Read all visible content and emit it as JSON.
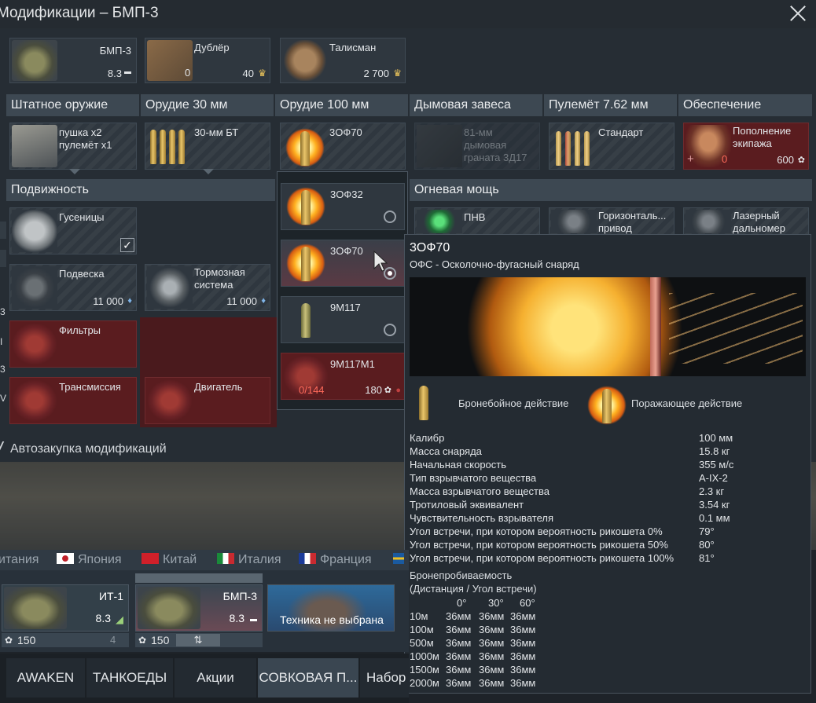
{
  "window": {
    "title": "Модификации – БМП-3"
  },
  "top_cards": [
    {
      "label": "БМП-3",
      "value": "8.3"
    },
    {
      "label": "Дублёр",
      "left_value": "0",
      "value": "40"
    },
    {
      "label": "Талисман",
      "value": "2 700"
    }
  ],
  "categories": {
    "standard_weapons": "Штатное оружие",
    "gun_30": "Орудие 30 мм",
    "gun_100": "Орудие 100 мм",
    "smoke": "Дымовая завеса",
    "mg": "Пулемёт 7.62 мм",
    "supply": "Обеспечение",
    "mobility": "Подвижность",
    "firepower": "Огневая мощь"
  },
  "weapon_cards": {
    "standard": "пушка x2\nпулемёт x1",
    "gun_30": "30-мм БТ",
    "gun_100": "3ОФ70",
    "smoke": "81-мм\nдымовая\nграната 3Д17",
    "mg": "Стандарт",
    "supply": {
      "label": "Пополнение\nэкипажа",
      "left_value": "0",
      "value": "600"
    }
  },
  "mobility_cards": [
    {
      "label": "Гусеницы"
    },
    {
      "label": "Подвеска",
      "value": "11 000"
    },
    {
      "label": "Тормозная\nсистема",
      "value": "11 000"
    },
    {
      "label": "Фильтры"
    },
    {
      "label": "Трансмиссия"
    },
    {
      "label": "Двигатель"
    }
  ],
  "firepower_cards": [
    {
      "label": "ПНВ"
    },
    {
      "label": "Горизонталь...\nпривод"
    },
    {
      "label": "Лазерный\nдальномер"
    }
  ],
  "left_edge_letters": [
    "3",
    "I",
    "3",
    "V"
  ],
  "autobuy": "Автозакупка модификаций",
  "dropdown": [
    {
      "label": "3ОФ32"
    },
    {
      "label": "3ОФ70"
    },
    {
      "label": "9М117"
    },
    {
      "label": "9М117М1",
      "left_value": "0/144",
      "value": "180"
    }
  ],
  "tooltip": {
    "title": "3ОФ70",
    "subtitle": "ОФС - Осколочно-фугасный снаряд",
    "effect_ap": "Бронебойное действие",
    "effect_he": "Поражающее действие",
    "stats": [
      {
        "k": "Калибр",
        "v": "100 мм"
      },
      {
        "k": "Масса снаряда",
        "v": "15.8 кг"
      },
      {
        "k": "Начальная скорость",
        "v": "355 м/с"
      },
      {
        "k": "Тип взрывчатого вещества",
        "v": "A-IX-2"
      },
      {
        "k": "Масса взрывчатого вещества",
        "v": "2.3 кг"
      },
      {
        "k": "Тротиловый эквивалент",
        "v": "3.54 кг"
      },
      {
        "k": "Чувствительность взрывателя",
        "v": "0.1 мм"
      },
      {
        "k": "Угол встречи, при котором вероятность рикошета 0%",
        "v": "79°"
      },
      {
        "k": "Угол встречи, при котором вероятность рикошета 50%",
        "v": "80°"
      },
      {
        "k": "Угол встречи, при котором вероятность рикошета 100%",
        "v": "81°"
      }
    ],
    "penetration_title": "Бронепробиваемость",
    "penetration_subtitle": "(Дистанция / Угол встречи)",
    "angles": [
      "0°",
      "30°",
      "60°"
    ],
    "pen_rows": [
      {
        "d": "10м",
        "a": "36мм",
        "b": "36мм",
        "c": "36мм"
      },
      {
        "d": "100м",
        "a": "36мм",
        "b": "36мм",
        "c": "36мм"
      },
      {
        "d": "500м",
        "a": "36мм",
        "b": "36мм",
        "c": "36мм"
      },
      {
        "d": "1000м",
        "a": "36мм",
        "b": "36мм",
        "c": "36мм"
      },
      {
        "d": "1500м",
        "a": "36мм",
        "b": "36мм",
        "c": "36мм"
      },
      {
        "d": "2000м",
        "a": "36мм",
        "b": "36мм",
        "c": "36мм"
      }
    ]
  },
  "nations": [
    "итания",
    "Япония",
    "Китай",
    "Италия",
    "Франция"
  ],
  "slots": [
    {
      "label": "ИТ-1",
      "br": "8.3",
      "cost": "150",
      "extra": "4"
    },
    {
      "label": "БМП-3",
      "br": "8.3",
      "cost": "150"
    },
    {
      "label": "Техника не выбрана"
    }
  ],
  "tabs": [
    "AWAKEN",
    "ТАНКОЕДЫ",
    "Акции",
    "СОВКОВАЯ П...",
    "Набор"
  ]
}
